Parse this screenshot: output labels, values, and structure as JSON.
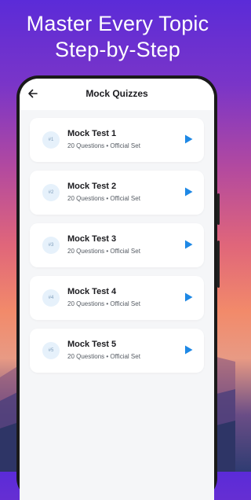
{
  "promo": {
    "headline_line1": "Master Every Topic",
    "headline_line2": "Step-by-Step"
  },
  "appbar": {
    "title": "Mock Quizzes",
    "back_icon": "back-arrow-icon"
  },
  "quizzes": [
    {
      "badge": "#1",
      "title": "Mock Test 1",
      "meta": "20 Questions • Official Set",
      "action_icon": "play-icon"
    },
    {
      "badge": "#2",
      "title": "Mock Test 2",
      "meta": "20 Questions • Official Set",
      "action_icon": "play-icon"
    },
    {
      "badge": "#3",
      "title": "Mock Test 3",
      "meta": "20 Questions • Official Set",
      "action_icon": "play-icon"
    },
    {
      "badge": "#4",
      "title": "Mock Test 4",
      "meta": "20 Questions • Official Set",
      "action_icon": "play-icon"
    },
    {
      "badge": "#5",
      "title": "Mock Test 5",
      "meta": "20 Questions • Official Set",
      "action_icon": "play-icon"
    }
  ],
  "colors": {
    "accent": "#1e88e5",
    "card_background": "#ffffff",
    "screen_background": "#f5f6f8",
    "badge_background": "#e6f1fb"
  }
}
